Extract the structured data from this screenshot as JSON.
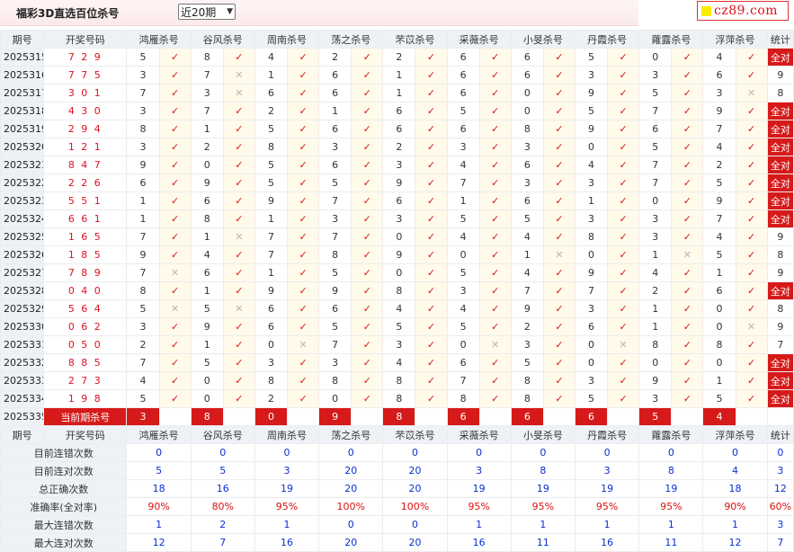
{
  "header": {
    "title": "福彩3D直选百位杀号",
    "period_select": "近20期",
    "brand": "cz89.com"
  },
  "columns": [
    "期号",
    "开奖号码",
    "鸿雁杀号",
    "谷风杀号",
    "周南杀号",
    "荡之杀号",
    "芣苡杀号",
    "采薇杀号",
    "小旻杀号",
    "丹霞杀号",
    "蕹露杀号",
    "浮萍杀号",
    "统计"
  ],
  "rows": [
    {
      "period": "2025315",
      "draw": "7 2 9",
      "values": [
        "5",
        "8",
        "4",
        "2",
        "2",
        "6",
        "6",
        "5",
        "0",
        "4"
      ],
      "hits": [
        1,
        1,
        1,
        1,
        1,
        1,
        1,
        1,
        1,
        1
      ],
      "stat": "全对"
    },
    {
      "period": "2025316",
      "draw": "7 7 5",
      "values": [
        "3",
        "7",
        "1",
        "6",
        "1",
        "6",
        "6",
        "3",
        "3",
        "6"
      ],
      "hits": [
        1,
        0,
        1,
        1,
        1,
        1,
        1,
        1,
        1,
        1
      ],
      "stat": "9"
    },
    {
      "period": "2025317",
      "draw": "3 0 1",
      "values": [
        "7",
        "3",
        "6",
        "6",
        "1",
        "6",
        "0",
        "9",
        "5",
        "3"
      ],
      "hits": [
        1,
        0,
        1,
        1,
        1,
        1,
        1,
        1,
        1,
        0
      ],
      "stat": "8"
    },
    {
      "period": "2025318",
      "draw": "4 3 0",
      "values": [
        "3",
        "7",
        "2",
        "1",
        "6",
        "5",
        "0",
        "5",
        "7",
        "9"
      ],
      "hits": [
        1,
        1,
        1,
        1,
        1,
        1,
        1,
        1,
        1,
        1
      ],
      "stat": "全对"
    },
    {
      "period": "2025319",
      "draw": "2 9 4",
      "values": [
        "8",
        "1",
        "5",
        "6",
        "6",
        "6",
        "8",
        "9",
        "6",
        "7"
      ],
      "hits": [
        1,
        1,
        1,
        1,
        1,
        1,
        1,
        1,
        1,
        1
      ],
      "stat": "全对"
    },
    {
      "period": "2025320",
      "draw": "1 2 1",
      "values": [
        "3",
        "2",
        "8",
        "3",
        "2",
        "3",
        "3",
        "0",
        "5",
        "4"
      ],
      "hits": [
        1,
        1,
        1,
        1,
        1,
        1,
        1,
        1,
        1,
        1
      ],
      "stat": "全对"
    },
    {
      "period": "2025321",
      "draw": "8 4 7",
      "values": [
        "9",
        "0",
        "5",
        "6",
        "3",
        "4",
        "6",
        "4",
        "7",
        "2"
      ],
      "hits": [
        1,
        1,
        1,
        1,
        1,
        1,
        1,
        1,
        1,
        1
      ],
      "stat": "全对"
    },
    {
      "period": "2025322",
      "draw": "2 2 6",
      "values": [
        "6",
        "9",
        "5",
        "5",
        "9",
        "7",
        "3",
        "3",
        "7",
        "5"
      ],
      "hits": [
        1,
        1,
        1,
        1,
        1,
        1,
        1,
        1,
        1,
        1
      ],
      "stat": "全对"
    },
    {
      "period": "2025323",
      "draw": "5 5 1",
      "values": [
        "1",
        "6",
        "9",
        "7",
        "6",
        "1",
        "6",
        "1",
        "0",
        "9"
      ],
      "hits": [
        1,
        1,
        1,
        1,
        1,
        1,
        1,
        1,
        1,
        1
      ],
      "stat": "全对"
    },
    {
      "period": "2025324",
      "draw": "6 6 1",
      "values": [
        "1",
        "8",
        "1",
        "3",
        "3",
        "5",
        "5",
        "3",
        "3",
        "7"
      ],
      "hits": [
        1,
        1,
        1,
        1,
        1,
        1,
        1,
        1,
        1,
        1
      ],
      "stat": "全对"
    },
    {
      "period": "2025325",
      "draw": "1 6 5",
      "values": [
        "7",
        "1",
        "7",
        "7",
        "0",
        "4",
        "4",
        "8",
        "3",
        "4"
      ],
      "hits": [
        1,
        0,
        1,
        1,
        1,
        1,
        1,
        1,
        1,
        1
      ],
      "stat": "9"
    },
    {
      "period": "2025326",
      "draw": "1 8 5",
      "values": [
        "9",
        "4",
        "7",
        "8",
        "9",
        "0",
        "1",
        "0",
        "1",
        "5"
      ],
      "hits": [
        1,
        1,
        1,
        1,
        1,
        1,
        0,
        1,
        0,
        1
      ],
      "stat": "8"
    },
    {
      "period": "2025327",
      "draw": "7 8 9",
      "values": [
        "7",
        "6",
        "1",
        "5",
        "0",
        "5",
        "4",
        "9",
        "4",
        "1"
      ],
      "hits": [
        0,
        1,
        1,
        1,
        1,
        1,
        1,
        1,
        1,
        1
      ],
      "stat": "9"
    },
    {
      "period": "2025328",
      "draw": "0 4 0",
      "values": [
        "8",
        "1",
        "9",
        "9",
        "8",
        "3",
        "7",
        "7",
        "2",
        "6"
      ],
      "hits": [
        1,
        1,
        1,
        1,
        1,
        1,
        1,
        1,
        1,
        1
      ],
      "stat": "全对"
    },
    {
      "period": "2025329",
      "draw": "5 6 4",
      "values": [
        "5",
        "5",
        "6",
        "6",
        "4",
        "4",
        "9",
        "3",
        "1",
        "0"
      ],
      "hits": [
        0,
        0,
        1,
        1,
        1,
        1,
        1,
        1,
        1,
        1
      ],
      "stat": "8"
    },
    {
      "period": "2025330",
      "draw": "0 6 2",
      "values": [
        "3",
        "9",
        "6",
        "5",
        "5",
        "5",
        "2",
        "6",
        "1",
        "0"
      ],
      "hits": [
        1,
        1,
        1,
        1,
        1,
        1,
        1,
        1,
        1,
        0
      ],
      "stat": "9"
    },
    {
      "period": "2025331",
      "draw": "0 5 0",
      "values": [
        "2",
        "1",
        "0",
        "7",
        "3",
        "0",
        "3",
        "0",
        "8",
        "8"
      ],
      "hits": [
        1,
        1,
        0,
        1,
        1,
        0,
        1,
        0,
        1,
        1
      ],
      "stat": "7"
    },
    {
      "period": "2025332",
      "draw": "8 8 5",
      "values": [
        "7",
        "5",
        "3",
        "3",
        "4",
        "6",
        "5",
        "0",
        "0",
        "0"
      ],
      "hits": [
        1,
        1,
        1,
        1,
        1,
        1,
        1,
        1,
        1,
        1
      ],
      "stat": "全对"
    },
    {
      "period": "2025333",
      "draw": "2 7 3",
      "values": [
        "4",
        "0",
        "8",
        "8",
        "8",
        "7",
        "8",
        "3",
        "9",
        "1"
      ],
      "hits": [
        1,
        1,
        1,
        1,
        1,
        1,
        1,
        1,
        1,
        1
      ],
      "stat": "全对"
    },
    {
      "period": "2025334",
      "draw": "1 9 8",
      "values": [
        "5",
        "0",
        "2",
        "0",
        "8",
        "8",
        "8",
        "5",
        "3",
        "5"
      ],
      "hits": [
        1,
        1,
        1,
        1,
        1,
        1,
        1,
        1,
        1,
        1
      ],
      "stat": "全对"
    }
  ],
  "current": {
    "period": "2025335",
    "label": "当前期杀号",
    "values": [
      "3",
      "8",
      "0",
      "9",
      "8",
      "6",
      "6",
      "6",
      "5",
      "4"
    ]
  },
  "footer_header": [
    "期号",
    "开奖号码",
    "鸿雁杀号",
    "谷风杀号",
    "周南杀号",
    "荡之杀号",
    "芣苡杀号",
    "采薇杀号",
    "小旻杀号",
    "丹霞杀号",
    "蕹露杀号",
    "浮萍杀号",
    "统计"
  ],
  "summary": [
    {
      "label": "目前连错次数",
      "color": "blue",
      "values": [
        "0",
        "0",
        "0",
        "0",
        "0",
        "0",
        "0",
        "0",
        "0",
        "0",
        "0"
      ]
    },
    {
      "label": "目前连对次数",
      "color": "blue",
      "values": [
        "5",
        "5",
        "3",
        "20",
        "20",
        "3",
        "8",
        "3",
        "8",
        "4",
        "3"
      ]
    },
    {
      "label": "总正确次数",
      "color": "blue",
      "values": [
        "18",
        "16",
        "19",
        "20",
        "20",
        "19",
        "19",
        "19",
        "19",
        "18",
        "12"
      ]
    },
    {
      "label": "准确率(全对率)",
      "color": "red",
      "values": [
        "90%",
        "80%",
        "95%",
        "100%",
        "100%",
        "95%",
        "95%",
        "95%",
        "95%",
        "90%",
        "60%"
      ]
    },
    {
      "label": "最大连错次数",
      "color": "blue",
      "values": [
        "1",
        "2",
        "1",
        "0",
        "0",
        "1",
        "1",
        "1",
        "1",
        "1",
        "3"
      ]
    },
    {
      "label": "最大连对次数",
      "color": "blue",
      "values": [
        "12",
        "7",
        "16",
        "20",
        "20",
        "16",
        "11",
        "16",
        "11",
        "12",
        "7"
      ]
    }
  ],
  "icons": {
    "hit": "check-mark-icon",
    "miss": "cross-mark-icon"
  },
  "colors": {
    "accent_red": "#d61a1a",
    "summary_blue": "#0b2fd0",
    "header_bg": "#eef2f6",
    "mark_bg": "#fffaea"
  }
}
